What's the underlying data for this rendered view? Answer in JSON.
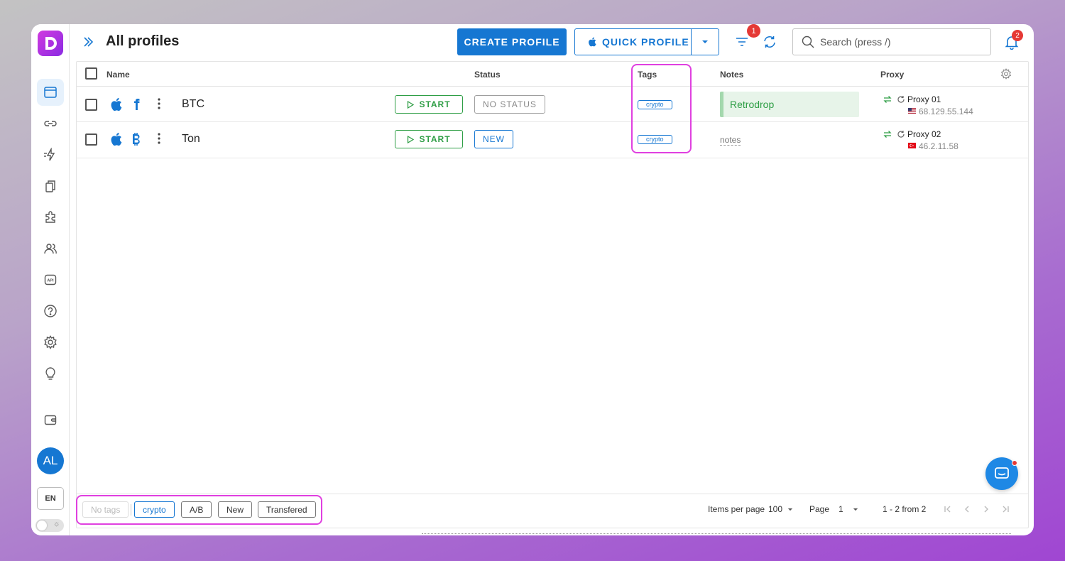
{
  "header": {
    "title": "All profiles",
    "create_label": "CREATE PROFILE",
    "quick_label": "QUICK PROFILE",
    "filter_badge": "1",
    "search_placeholder": "Search (press /)",
    "notification_badge": "2"
  },
  "sidebar": {
    "avatar_initials": "AL",
    "language": "EN",
    "items": [
      "browser-profiles-icon",
      "link-icon",
      "automation-icon",
      "copy-icon",
      "puzzle-icon",
      "users-icon",
      "api-icon",
      "help-icon",
      "settings-icon",
      "lightbulb-icon",
      "wallet-icon"
    ]
  },
  "table": {
    "columns": {
      "name": "Name",
      "status": "Status",
      "tags": "Tags",
      "notes": "Notes",
      "proxy": "Proxy"
    },
    "start_label": "START",
    "rows": [
      {
        "name": "BTC",
        "os_icon": "apple-icon",
        "browser_icon": "f-icon",
        "status": "NO STATUS",
        "tag": "crypto",
        "note": "Retrodrop",
        "proxy_name": "Proxy 01",
        "proxy_ip": "68.129.55.144",
        "flag": "us"
      },
      {
        "name": "Ton",
        "os_icon": "apple-icon",
        "browser_icon": "bitcoin-icon",
        "status": "NEW",
        "tag": "crypto",
        "note": "notes",
        "proxy_name": "Proxy 02",
        "proxy_ip": "46.2.11.58",
        "flag": "tr"
      }
    ]
  },
  "footer": {
    "tag_filters": [
      "No tags",
      "crypto",
      "A/B",
      "New",
      "Transfered"
    ],
    "items_per_page_label": "Items per page",
    "items_per_page_value": "100",
    "page_label": "Page",
    "page_value": "1",
    "range_text": "1 - 2 from 2"
  },
  "colors": {
    "primary": "#1677d2",
    "success": "#2e9e45",
    "highlight": "#e040e0",
    "badge": "#e53935"
  }
}
